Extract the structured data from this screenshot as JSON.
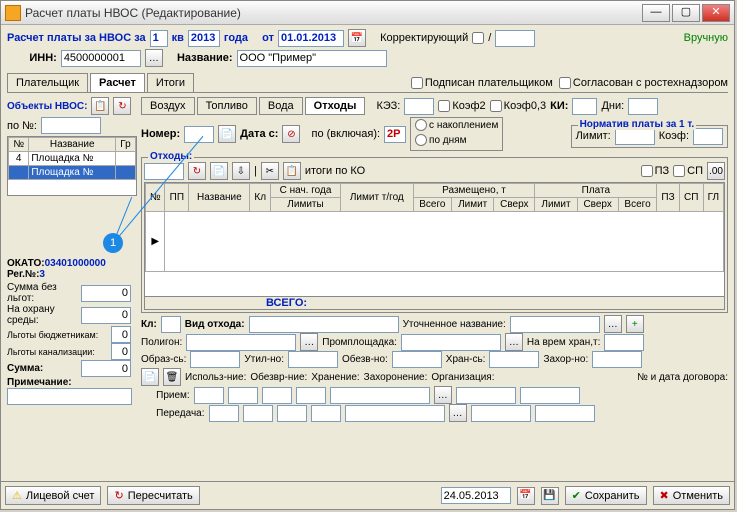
{
  "window": {
    "title": "Расчет платы НВОС (Редактирование)"
  },
  "header": {
    "prefix": "Расчет платы за НВОС за",
    "quarter": "1",
    "kv": "кв",
    "year": "2013",
    "goda": "года",
    "ot": "от",
    "date": "01.01.2013",
    "corr": "Корректирующий",
    "manual": "Вручную"
  },
  "line2": {
    "inn_label": "ИНН:",
    "inn": "4500000001",
    "name_label": "Название:",
    "name": "ООО \"Пример\""
  },
  "tabs": [
    "Плательщик",
    "Расчет",
    "Итоги"
  ],
  "signed": "Подписан плательщиком",
  "approved": "Согласован с ростехнадзором",
  "objects_label": "Объекты НВОС:",
  "pono": "по №:",
  "grid1": {
    "headers": [
      "№",
      "Название",
      "Гр"
    ],
    "rows": [
      {
        "no": "4",
        "name": "Площадка №",
        "gr": ""
      },
      {
        "no": "",
        "name": "Площадка №",
        "gr": ""
      }
    ]
  },
  "left_bottom": {
    "okato_label": "ОКАТО:",
    "okato": "03401000000",
    "reg_label": "Рег.№:",
    "reg": "3",
    "sum_no_disc": "Сумма без льгот:",
    "sum_no_disc_v": "0",
    "env": "На охрану среды:",
    "env_v": "0",
    "budget": "Льготы бюджетникам:",
    "budget_v": "0",
    "sewer": "Льготы канализации:",
    "sewer_v": "0",
    "sum": "Сумма:",
    "sum_v": "0",
    "note": "Примечание:"
  },
  "subtabs": [
    "Воздух",
    "Топливо",
    "Вода",
    "Отходы"
  ],
  "kez": "КЭЗ:",
  "koef2": "Коэф2",
  "koef03": "Коэф0,3",
  "ki": "КИ:",
  "dni": "Дни:",
  "nomer": "Номер:",
  "data_s": "Дата с:",
  "po_vkl": "по (включая):",
  "po_vkl_v": "2Р",
  "accum": "с накоплением",
  "bydays": "по дням",
  "norm": "Норматив платы за 1 т.",
  "limit": "Лимит:",
  "koef": "Коэф:",
  "otkhody_l": "Отходы:",
  "itogi_ko": "итоги по КО",
  "pz": "ПЗ",
  "sp": "СП",
  "grid2": {
    "h1": [
      "№",
      "ПП",
      "Название",
      "Кл"
    ],
    "snach": "С нач. года",
    "lim_god": "Лимит т/год",
    "razm": "Размещено, т",
    "plata": "Плата",
    "sub": [
      "Лимиты",
      "Всего",
      "Лимит",
      "Сверх",
      "Лимит",
      "Сверх",
      "Всего"
    ],
    "tail": [
      "ПЗ",
      "СП",
      "ГЛ"
    ],
    "total": "ВСЕГО:"
  },
  "detail": {
    "kl": "Кл:",
    "vid": "Вид отхода:",
    "utoch": "Уточненное название:",
    "poligon": "Полигон:",
    "prom": "Промплощадка:",
    "navrem": "На врем хран,т:",
    "obraz": "Образ-сь:",
    "util": "Утил-но:",
    "obez": "Обезв-но:",
    "hran": "Хран-сь:",
    "zahor": "Захор-но:",
    "isp": "Использ-ние:",
    "obezvr": "Обезвр-ние:",
    "hranenie": "Хранение:",
    "zahoronenie": "Захоронение:",
    "org": "Организация:",
    "dogovor": "№ и дата договора:",
    "priem": "Прием:",
    "peredacha": "Передача:"
  },
  "footer": {
    "acct": "Лицевой счет",
    "recalc": "Пересчитать",
    "date": "24.05.2013",
    "save": "Сохранить",
    "cancel": "Отменить"
  }
}
